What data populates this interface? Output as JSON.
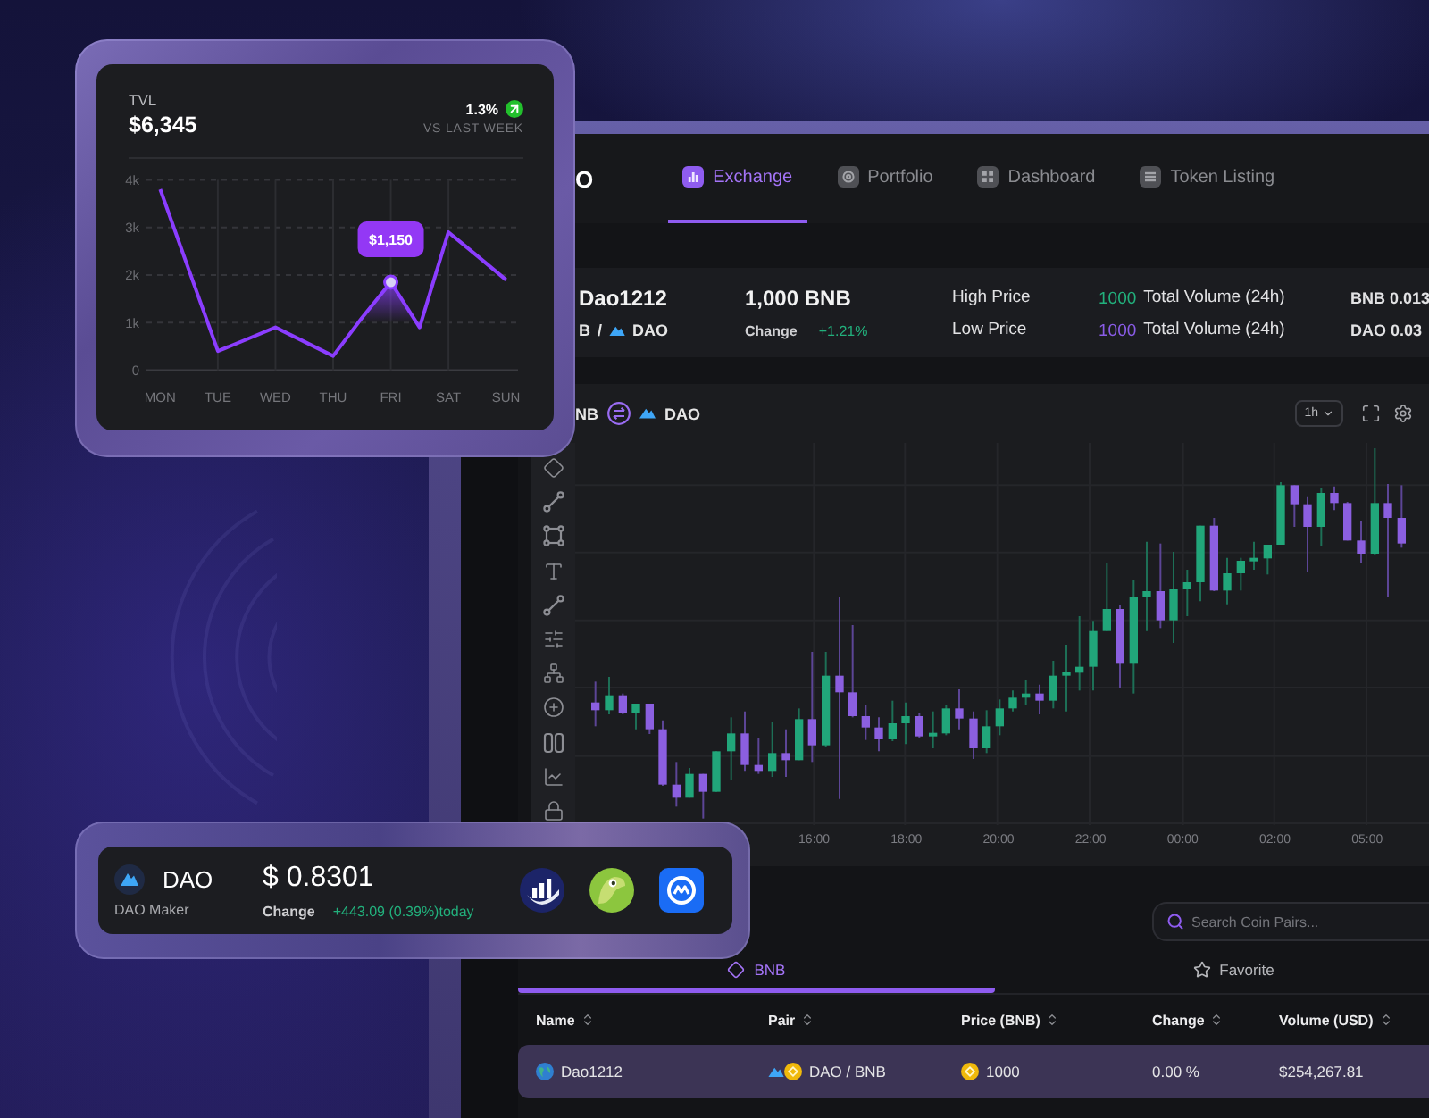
{
  "tvl_card": {
    "value": "$6,345",
    "change": "1.3%",
    "trend_up": true,
    "comparison": "VS LAST WEEK",
    "chart_data": {
      "type": "line",
      "title": "TVL",
      "grid": true,
      "categories": [
        "MON",
        null,
        "TUE",
        null,
        "WED",
        null,
        "THU",
        null,
        "FRI",
        null,
        "SAT",
        null,
        "SUN"
      ],
      "series": [
        {
          "color": "#8b3dff",
          "values": [
            3800,
            2100,
            400,
            650,
            900,
            600,
            300,
            1100,
            1850,
            900,
            2900,
            2400,
            1900
          ]
        }
      ],
      "ylim": [
        0,
        4000
      ],
      "yticks": [
        {
          "value": 0,
          "label": "0"
        },
        {
          "value": 1000,
          "label": "1k"
        },
        {
          "value": 2000,
          "label": "2k"
        },
        {
          "value": 3000,
          "label": "3k"
        },
        {
          "value": 4000,
          "label": "4k"
        }
      ],
      "annotations": [
        {
          "x": "FRI",
          "y": 1850,
          "text": "$1,150"
        }
      ]
    }
  },
  "exchange": {
    "logo_text": "O",
    "nav_tabs": [
      {
        "label": "Exchange",
        "selected": true
      },
      {
        "label": "Portfolio",
        "selected": false
      },
      {
        "label": "Dashboard",
        "selected": false
      },
      {
        "label": "Token Listing",
        "selected": false
      }
    ],
    "pair_summary": {
      "name": "Dao1212",
      "base": "B",
      "separator": "/",
      "quote": "DAO",
      "price": "1,000 BNB",
      "change_label": "Change",
      "change_value": "+1.21%",
      "high_label": "High Price",
      "low_label": "Low Price",
      "volumes": [
        {
          "value": "1000",
          "label": "Total Volume (24h)",
          "color": "#22b07c"
        },
        {
          "value": "1000",
          "label": "Total Volume (24h)",
          "color": "#8a5ce6"
        }
      ],
      "balances": [
        "BNB 0.013",
        "DAO 0.03"
      ]
    },
    "chart": {
      "base": "NB",
      "quote": "DAO",
      "interval": "1h",
      "time_labels": [
        "16:00",
        "18:00",
        "20:00",
        "22:00",
        "00:00",
        "02:00",
        "05:00"
      ]
    },
    "pairs_panel": {
      "search": {
        "placeholder": "Search Coin Pairs..."
      },
      "tabs": [
        {
          "label": "BNB",
          "selected": true
        },
        {
          "label": "Favorite",
          "selected": false
        }
      ],
      "columns": [
        "Name",
        "Pair",
        "Price (BNB)",
        "Change",
        "Volume (USD)"
      ],
      "rows": [
        {
          "name": "Dao1212",
          "pair": "DAO / BNB",
          "price": "1000",
          "change": "0.00 %",
          "volume": "$254,267.81",
          "selected": true
        }
      ]
    }
  },
  "token_card": {
    "symbol": "DAO",
    "name": "DAO Maker",
    "price": "$ 0.8301",
    "change_label": "Change",
    "change_value": "+443.09 (0.39%)today"
  }
}
